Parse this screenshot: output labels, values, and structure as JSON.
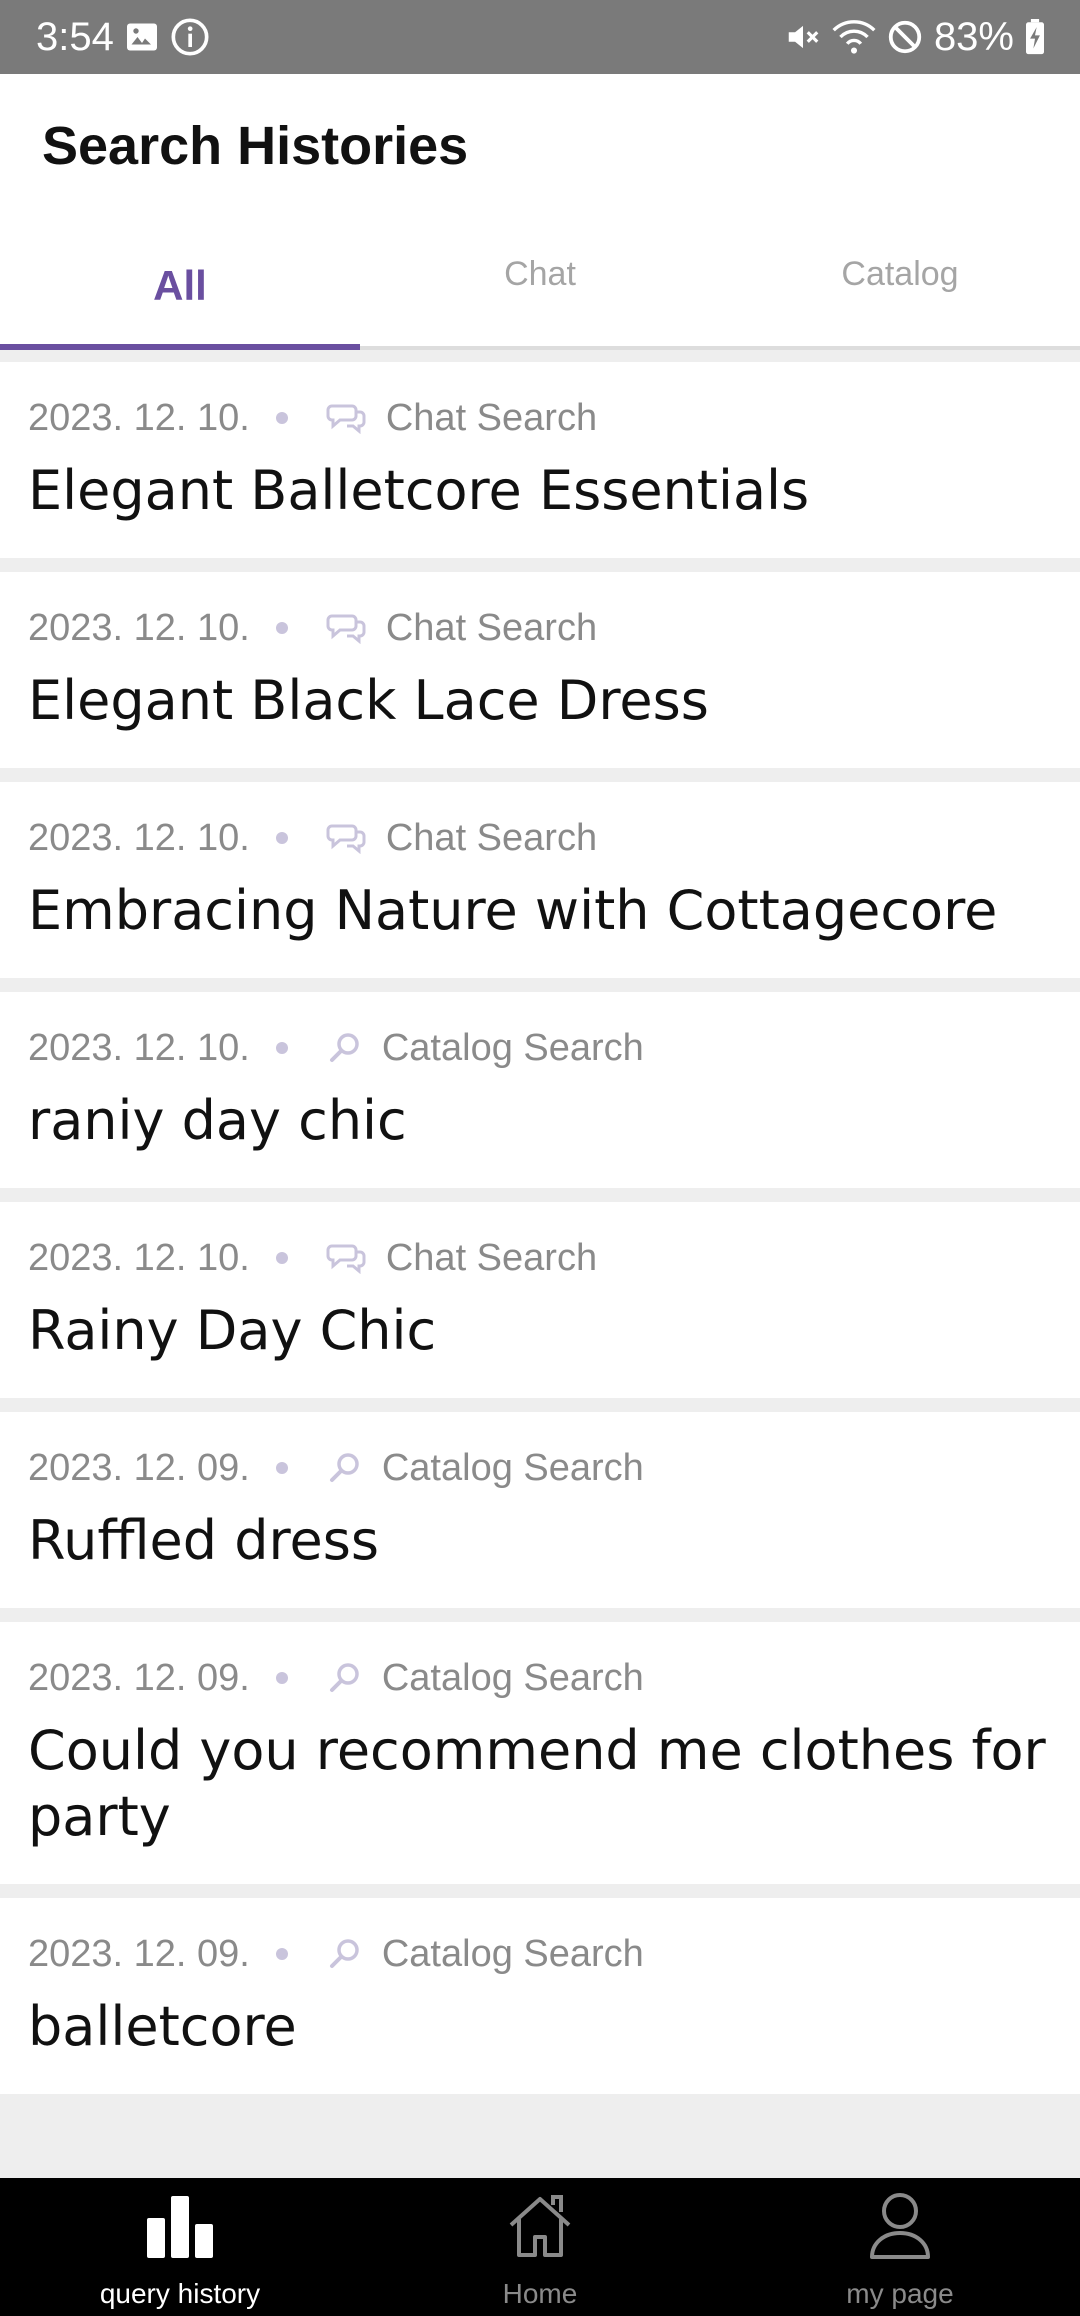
{
  "status_bar": {
    "time": "3:54",
    "battery_percent": "83%",
    "icons": [
      "image-icon",
      "info-icon",
      "mute-icon",
      "wifi-icon",
      "block-icon",
      "battery-icon"
    ]
  },
  "header": {
    "title": "Search Histories"
  },
  "tabs": [
    {
      "label": "All",
      "active": true
    },
    {
      "label": "Chat",
      "active": false
    },
    {
      "label": "Catalog",
      "active": false
    }
  ],
  "history": [
    {
      "date": "2023. 12. 10.",
      "type": "Chat Search",
      "icon": "chat-icon",
      "title": "Elegant Balletcore Essentials"
    },
    {
      "date": "2023. 12. 10.",
      "type": "Chat Search",
      "icon": "chat-icon",
      "title": "Elegant Black Lace Dress"
    },
    {
      "date": "2023. 12. 10.",
      "type": "Chat Search",
      "icon": "chat-icon",
      "title": "Embracing Nature with Cottagecore"
    },
    {
      "date": "2023. 12. 10.",
      "type": "Catalog Search",
      "icon": "search-icon",
      "title": "raniy day chic"
    },
    {
      "date": "2023. 12. 10.",
      "type": "Chat Search",
      "icon": "chat-icon",
      "title": "Rainy Day Chic"
    },
    {
      "date": "2023. 12. 09.",
      "type": "Catalog Search",
      "icon": "search-icon",
      "title": "Ruffled dress"
    },
    {
      "date": "2023. 12. 09.",
      "type": "Catalog Search",
      "icon": "search-icon",
      "title": "Could you recommend me clothes for party"
    },
    {
      "date": "2023. 12. 09.",
      "type": "Catalog Search",
      "icon": "search-icon",
      "title": "balletcore"
    }
  ],
  "bottom_nav": [
    {
      "label": "query history",
      "icon": "bar-chart-icon",
      "active": true
    },
    {
      "label": "Home",
      "icon": "home-icon",
      "active": false
    },
    {
      "label": "my page",
      "icon": "person-icon",
      "active": false
    }
  ],
  "colors": {
    "accent": "#6a4fa0",
    "status_bar": "#7a7a7a",
    "nav_bg": "#000000",
    "muted": "#8a8a8a"
  }
}
